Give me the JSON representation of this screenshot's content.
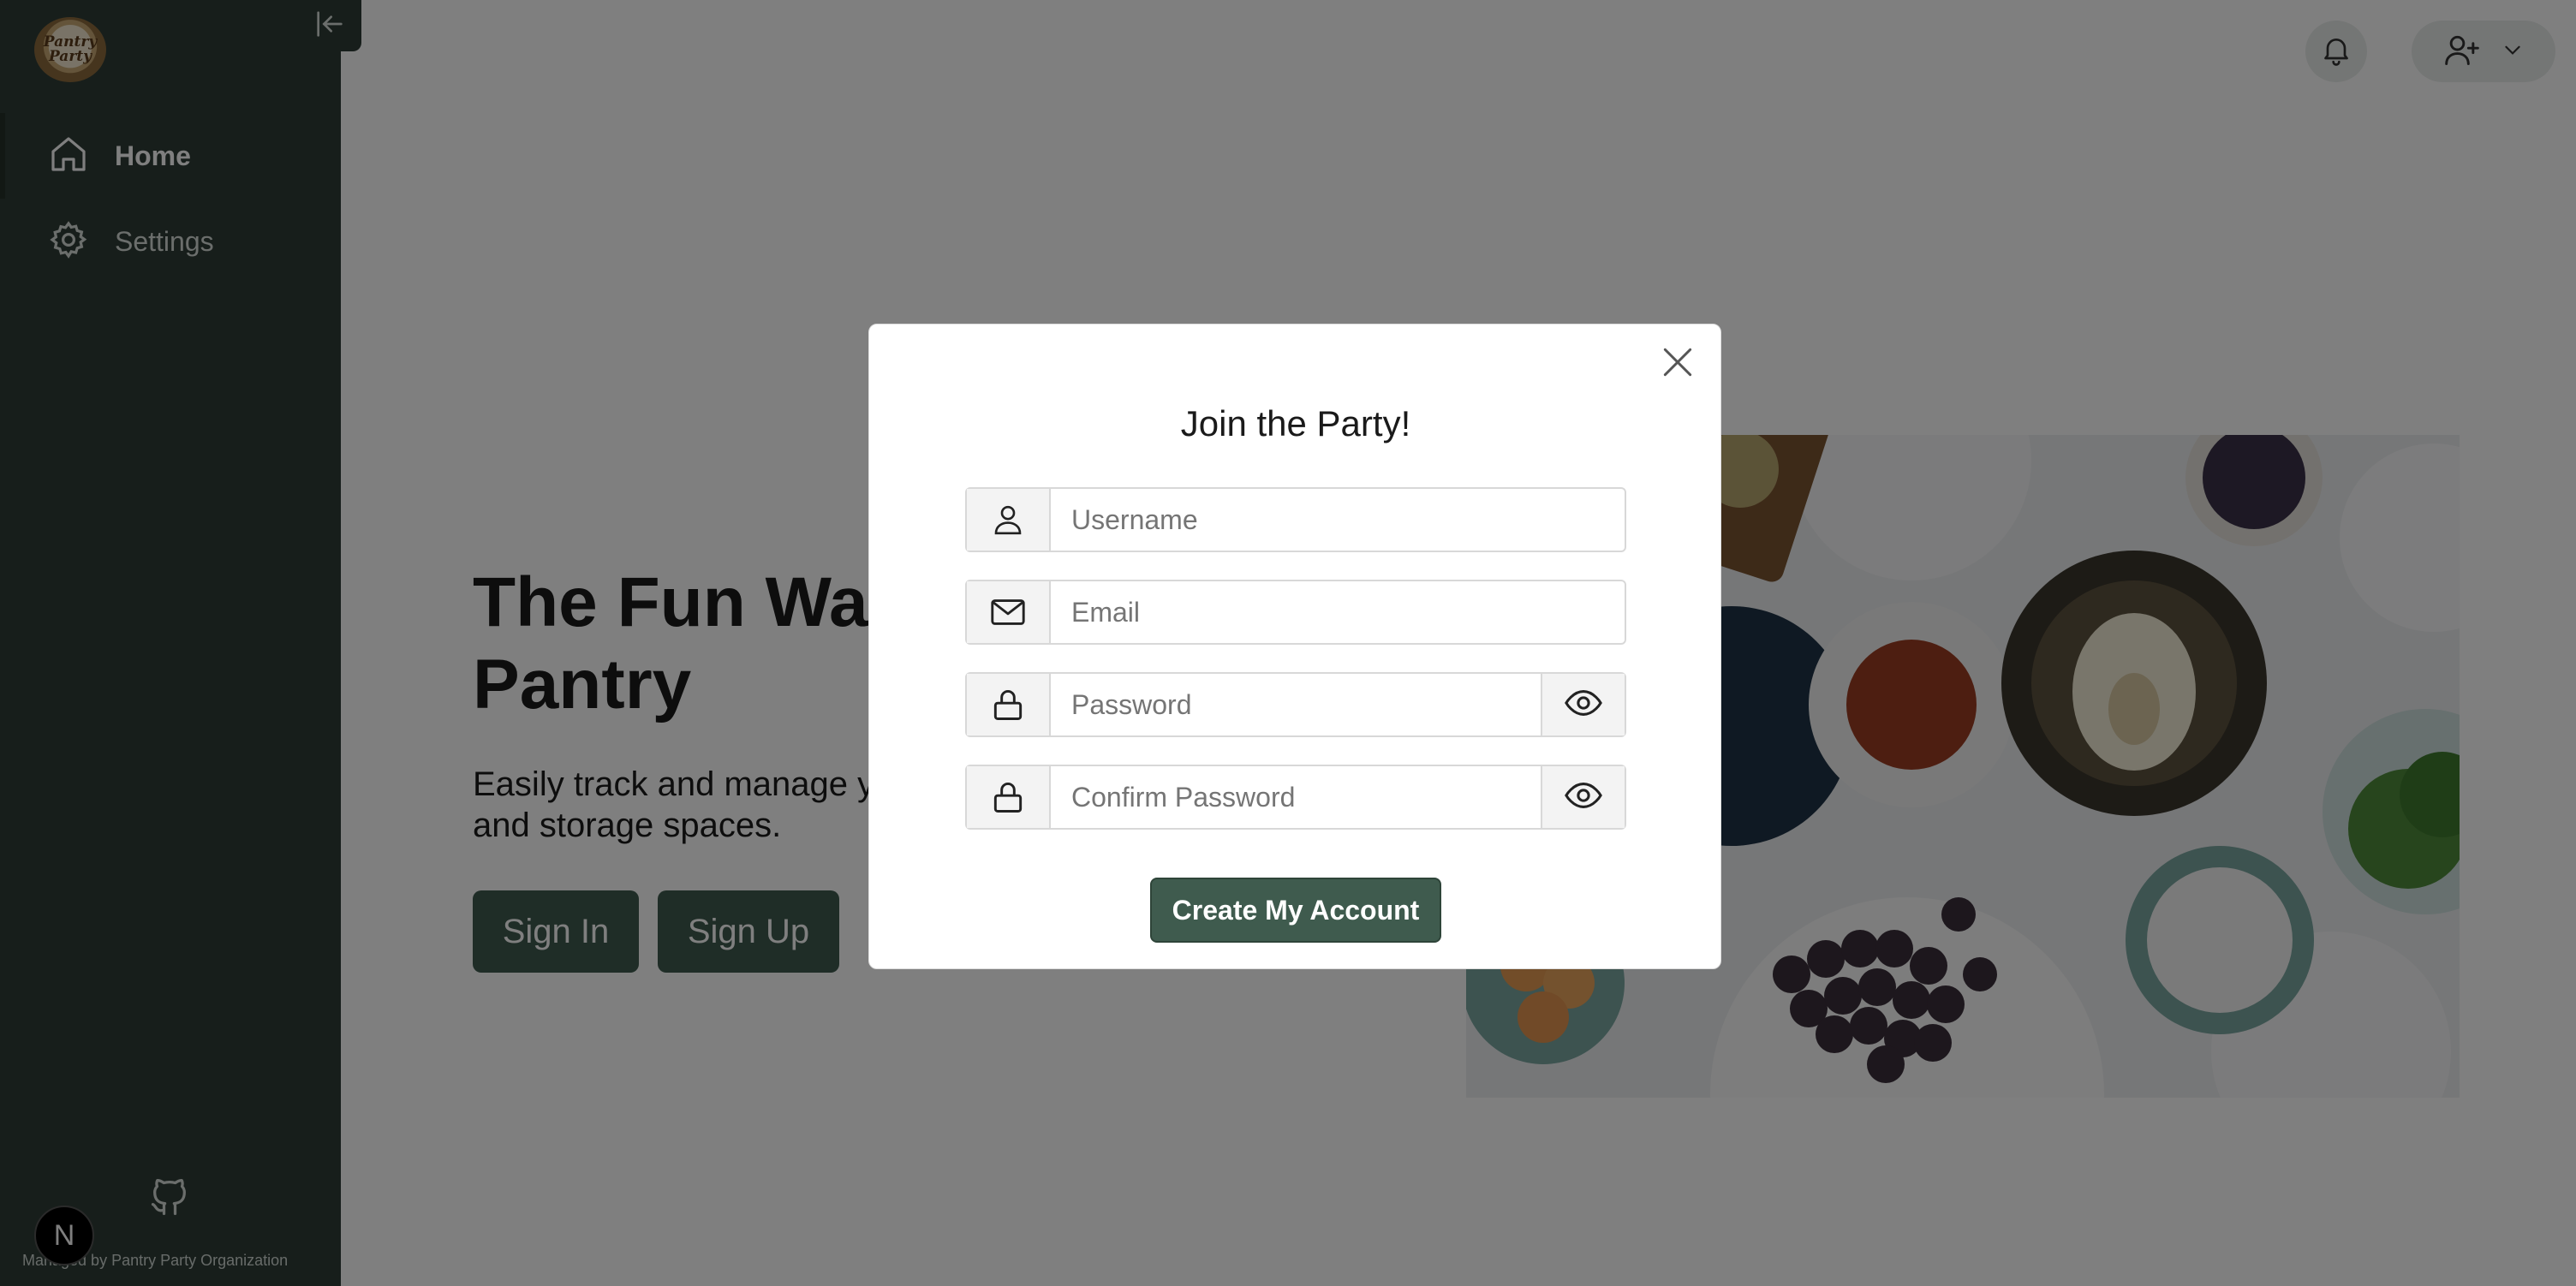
{
  "sidebar": {
    "logo_text": "Pantry Party",
    "items": [
      {
        "label": "Home",
        "icon": "home-icon",
        "active": true
      },
      {
        "label": "Settings",
        "icon": "gear-icon",
        "active": false
      }
    ],
    "footer_text": "Managed by Pantry Party Organization",
    "next_badge": "N"
  },
  "header": {
    "bell_icon": "bell-icon",
    "user_menu_icon": "user-plus-icon"
  },
  "hero": {
    "title": "The Fun Way to Manage Your Pantry",
    "subtitle": "Easily track and manage your pantry across multiple kitchens and storage spaces.",
    "signin_label": "Sign In",
    "signup_label": "Sign Up"
  },
  "modal": {
    "title": "Join the Party!",
    "fields": [
      {
        "placeholder": "Username",
        "icon": "user-icon",
        "type": "text"
      },
      {
        "placeholder": "Email",
        "icon": "mail-icon",
        "type": "email"
      },
      {
        "placeholder": "Password",
        "icon": "lock-icon",
        "type": "password"
      },
      {
        "placeholder": "Confirm Password",
        "icon": "lock-icon",
        "type": "password"
      }
    ],
    "submit_label": "Create My Account"
  },
  "colors": {
    "sidebar_bg": "#2f3d36",
    "accent": "#3f5b4e"
  }
}
